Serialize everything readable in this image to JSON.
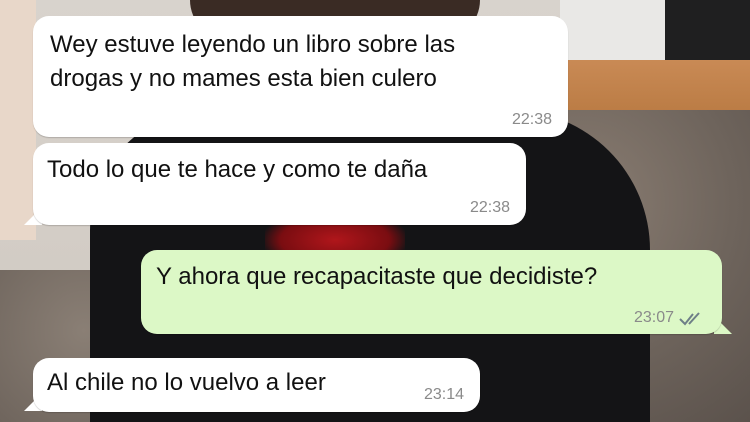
{
  "chat": {
    "messages": [
      {
        "direction": "incoming",
        "lines": [
          "Wey estuve leyendo un libro sobre las",
          "drogas y no mames esta bien culero"
        ],
        "time": "22:38"
      },
      {
        "direction": "incoming",
        "lines": [
          "Todo lo que te hace y como te daña"
        ],
        "time": "22:38"
      },
      {
        "direction": "outgoing",
        "lines": [
          "Y ahora que recapacitaste que decidiste?"
        ],
        "time": "23:07",
        "status": "read-double-check-icon"
      },
      {
        "direction": "incoming",
        "lines": [
          "Al chile no lo vuelvo a leer"
        ],
        "time": "23:14"
      }
    ]
  },
  "colors": {
    "incoming_bubble": "#ffffff",
    "outgoing_bubble": "#dcf8c6",
    "timestamp": "#8a8a8a",
    "read_ticks": "#6e7f87"
  }
}
